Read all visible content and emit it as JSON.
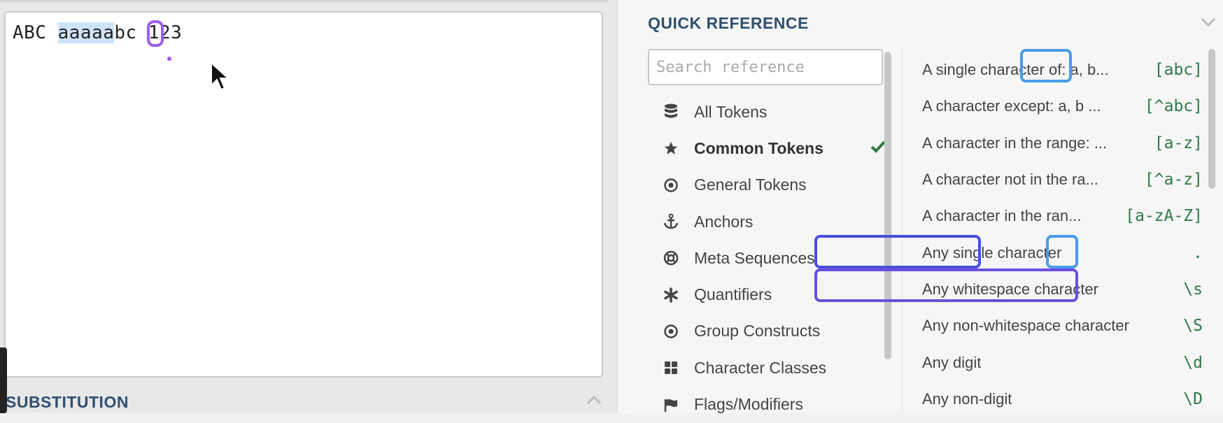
{
  "editor": {
    "text_before": "ABC ",
    "text_highlight": "aaaaa",
    "text_after": "bc 123"
  },
  "substitution": {
    "title": "SUBSTITUTION"
  },
  "quick_reference": {
    "title": "QUICK REFERENCE",
    "search_placeholder": "Search reference",
    "categories": [
      {
        "label": "All Tokens",
        "icon": "database-icon"
      },
      {
        "label": "Common Tokens",
        "icon": "star-icon",
        "active": true
      },
      {
        "label": "General Tokens",
        "icon": "target-icon"
      },
      {
        "label": "Anchors",
        "icon": "anchor-icon"
      },
      {
        "label": "Meta Sequences",
        "icon": "lifebuoy-icon"
      },
      {
        "label": "Quantifiers",
        "icon": "asterisk-icon"
      },
      {
        "label": "Group Constructs",
        "icon": "target-icon"
      },
      {
        "label": "Character Classes",
        "icon": "grid-icon"
      },
      {
        "label": "Flags/Modifiers",
        "icon": "flag-icon"
      }
    ],
    "tokens": [
      {
        "desc": "A single character of: a, b...",
        "code": "[abc]"
      },
      {
        "desc": "A character except: a, b ...",
        "code": "[^abc]"
      },
      {
        "desc": "A character in the range: ...",
        "code": "[a-z]"
      },
      {
        "desc": "A character not in the ra...",
        "code": "[^a-z]"
      },
      {
        "desc": "A character in the ran...",
        "code": "[a-zA-Z]"
      },
      {
        "desc": "Any single character",
        "code": "."
      },
      {
        "desc": "Any whitespace character",
        "code": "\\s"
      },
      {
        "desc": "Any non-whitespace character",
        "code": "\\S"
      },
      {
        "desc": "Any digit",
        "code": "\\d"
      },
      {
        "desc": "Any non-digit",
        "code": "\\D"
      }
    ]
  },
  "colors": {
    "accent_blue": "#4a9be8",
    "accent_indigo": "#4a4fd6",
    "accent_purple": "#9b5cf0",
    "token_green": "#2e7a47",
    "heading": "#2f4f6f"
  }
}
